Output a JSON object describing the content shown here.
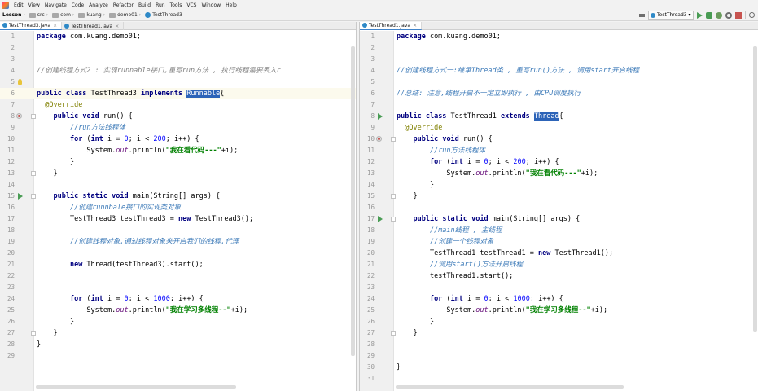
{
  "menu": {
    "items": [
      "Edit",
      "View",
      "Navigate",
      "Code",
      "Analyze",
      "Refactor",
      "Build",
      "Run",
      "Tools",
      "VCS",
      "Window",
      "Help"
    ]
  },
  "breadcrumb": [
    "Lesson",
    "src",
    "com",
    "kuang",
    "demo01",
    "TestThread3"
  ],
  "run_config": {
    "label": "TestThread3"
  },
  "left": {
    "tabs": [
      {
        "label": "TestThread3.java",
        "active": true
      },
      {
        "label": "TestThread1.java",
        "active": false
      }
    ],
    "line_numbers": [
      "1",
      "2",
      "3",
      "4",
      "5",
      "6",
      "7",
      "8",
      "9",
      "10",
      "11",
      "12",
      "13",
      "14",
      "15",
      "16",
      "17",
      "18",
      "19",
      "20",
      "21",
      "22",
      "23",
      "24",
      "25",
      "26",
      "27",
      "28",
      "29"
    ],
    "code": {
      "l1_kw": "package",
      "l1_rest": " com.kuang.demo01;",
      "l4": "//创建线程方式2 : 实现runnable接口,重写run方法 , 执行线程需要丢入r",
      "l6_kw1": "public",
      "l6_kw2": " class",
      "l6_name": " TestThread3",
      "l6_kw3": " implements",
      "l6_sp": " ",
      "l6_sel": "Runnable",
      "l6_end": "{",
      "l7": "@Override",
      "l8_kw1": "public",
      "l8_kw2": " void",
      "l8_rest": " run() {",
      "l9": "//run方法线程体",
      "l10_kw": "for",
      "l10_a": " (",
      "l10_kw2": "int",
      "l10_b": " i = ",
      "l10_n1": "0",
      "l10_c": "; i < ",
      "l10_n2": "200",
      "l10_d": "; i++) {",
      "l11_a": "System.",
      "l11_f": "out",
      "l11_b": ".println(",
      "l11_s": "\"我在看代码---\"",
      "l11_c": "+i);",
      "l12": "}",
      "l13": "}",
      "l15_kw1": "public",
      "l15_kw2": " static",
      "l15_kw3": " void",
      "l15_rest": " main(String[] args) {",
      "l16": "//创建runnbale接口的实现类对象",
      "l17_a": "TestThread3 testThread3 = ",
      "l17_kw": "new",
      "l17_b": " TestThread3();",
      "l19": "//创建线程对象,通过线程对象来开启我们的线程,代理",
      "l21_kw": "new",
      "l21_rest": " Thread(testThread3).start();",
      "l24_kw": "for",
      "l24_a": " (",
      "l24_kw2": "int",
      "l24_b": " i = ",
      "l24_n1": "0",
      "l24_c": "; i < ",
      "l24_n2": "1000",
      "l24_d": "; i++) {",
      "l25_a": "System.",
      "l25_f": "out",
      "l25_b": ".println(",
      "l25_s": "\"我在学习多线程--\"",
      "l25_c": "+i);",
      "l26": "}",
      "l27": "}",
      "l28": "}"
    }
  },
  "right": {
    "tabs": [
      {
        "label": "TestThread1.java",
        "active": true
      }
    ],
    "line_numbers": [
      "1",
      "2",
      "3",
      "4",
      "5",
      "6",
      "7",
      "8",
      "9",
      "10",
      "11",
      "12",
      "13",
      "14",
      "15",
      "16",
      "17",
      "18",
      "19",
      "20",
      "21",
      "22",
      "23",
      "24",
      "25",
      "26",
      "27",
      "28",
      "29",
      "30",
      "31"
    ],
    "code": {
      "l1_kw": "package",
      "l1_rest": " com.kuang.demo01;",
      "l4": "//创建线程方式一:继承Thread类 , 重写run()方法 , 调用start开启线程",
      "l6": "//总结: 注意,线程开启不一定立即执行 , 由CPU调度执行",
      "l8_kw1": "public",
      "l8_kw2": " class",
      "l8_name": " TestThread1",
      "l8_kw3": " extends",
      "l8_sp": " ",
      "l8_sel": "Thread",
      "l8_end": "{",
      "l9": "@Override",
      "l10_kw1": "public",
      "l10_kw2": " void",
      "l10_rest": " run() {",
      "l11": "//run方法线程体",
      "l12_kw": "for",
      "l12_a": " (",
      "l12_kw2": "int",
      "l12_b": " i = ",
      "l12_n1": "0",
      "l12_c": "; i < ",
      "l12_n2": "200",
      "l12_d": "; i++) {",
      "l13_a": "System.",
      "l13_f": "out",
      "l13_b": ".println(",
      "l13_s": "\"我在看代码---\"",
      "l13_c": "+i);",
      "l14": "}",
      "l15": "}",
      "l17_kw1": "public",
      "l17_kw2": " static",
      "l17_kw3": " void",
      "l17_rest": " main(String[] args) {",
      "l18": "//main线程 , 主线程",
      "l19": "//创建一个线程对象",
      "l20_a": "TestThread1 testThread1 = ",
      "l20_kw": "new",
      "l20_b": " TestThread1();",
      "l21": "//调用start()方法开启线程",
      "l22": "testThread1.start();",
      "l24_kw": "for",
      "l24_a": " (",
      "l24_kw2": "int",
      "l24_b": " i = ",
      "l24_n1": "0",
      "l24_c": "; i < ",
      "l24_n2": "1000",
      "l24_d": "; i++) {",
      "l25_a": "System.",
      "l25_f": "out",
      "l25_b": ".println(",
      "l25_s": "\"我在学习多线程--\"",
      "l25_c": "+i);",
      "l26": "}",
      "l27": "}",
      "l30": "}"
    }
  },
  "colors": {
    "keyword": "#000080",
    "string": "#008000",
    "number": "#0000ff",
    "comment": "#808080",
    "selection": "#2d64b8",
    "run_marker": "#499c54",
    "play_overlay": "#ffffff"
  },
  "icons": [
    "run-icon",
    "debug-icon",
    "search-icon",
    "play-overlay-icon",
    "override-icon",
    "fold-icon",
    "bulb-icon"
  ]
}
